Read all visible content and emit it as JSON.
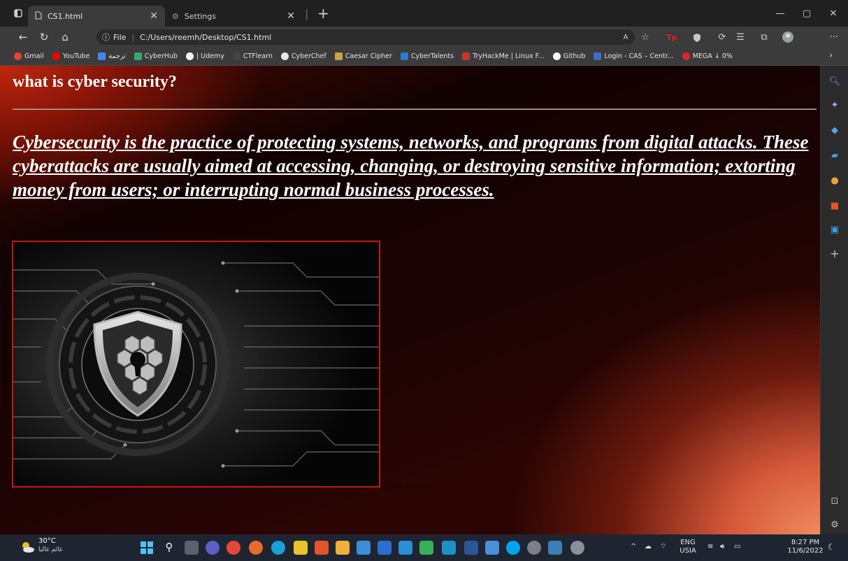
{
  "browser": {
    "tabs": [
      {
        "title": "CS1.html",
        "active": true
      },
      {
        "title": "Settings",
        "active": false
      }
    ],
    "address": {
      "scheme_label": "File",
      "url": "C:/Users/reemh/Desktop/CS1.html"
    },
    "bookmarks": [
      {
        "label": "Gmail",
        "color": "#ea4335"
      },
      {
        "label": "YouTube",
        "color": "#ff0000"
      },
      {
        "label": "ترجمة",
        "color": "#4285f4"
      },
      {
        "label": "CyberHub",
        "color": "#3aa56a"
      },
      {
        "label": "| Udemy",
        "color": "#ffffff"
      },
      {
        "label": "CTFlearn",
        "color": "#444444"
      },
      {
        "label": "CyberChef",
        "color": "#e6e6e6"
      },
      {
        "label": "Caesar Cipher",
        "color": "#c9a34a"
      },
      {
        "label": "CyberTalents",
        "color": "#2a7bd6"
      },
      {
        "label": "TryHackMe | Linux F...",
        "color": "#c0392b"
      },
      {
        "label": "Github",
        "color": "#ffffff"
      },
      {
        "label": "Login - CAS – Centr...",
        "color": "#3b6fc1"
      },
      {
        "label": "MEGA ↓ 0%",
        "color": "#d9272e"
      }
    ]
  },
  "page": {
    "heading": "what is cyber security?",
    "paragraph": "Cybersecurity is the practice of protecting systems, networks, and programs from digital attacks. These cyberattacks are usually aimed at accessing, changing, or destroying sensitive information; extorting money from users; or interrupting normal business processes.",
    "image_caption": "Cyber Security"
  },
  "taskbar": {
    "weather_temp": "30°C",
    "weather_desc": "غائم غالبا",
    "lang_top": "ENG",
    "lang_bottom": "USIA",
    "time": "8:27 PM",
    "date": "11/6/2022"
  },
  "colors": {
    "accent_red": "#c41a10",
    "gradient_warm": "#f08b5e"
  }
}
